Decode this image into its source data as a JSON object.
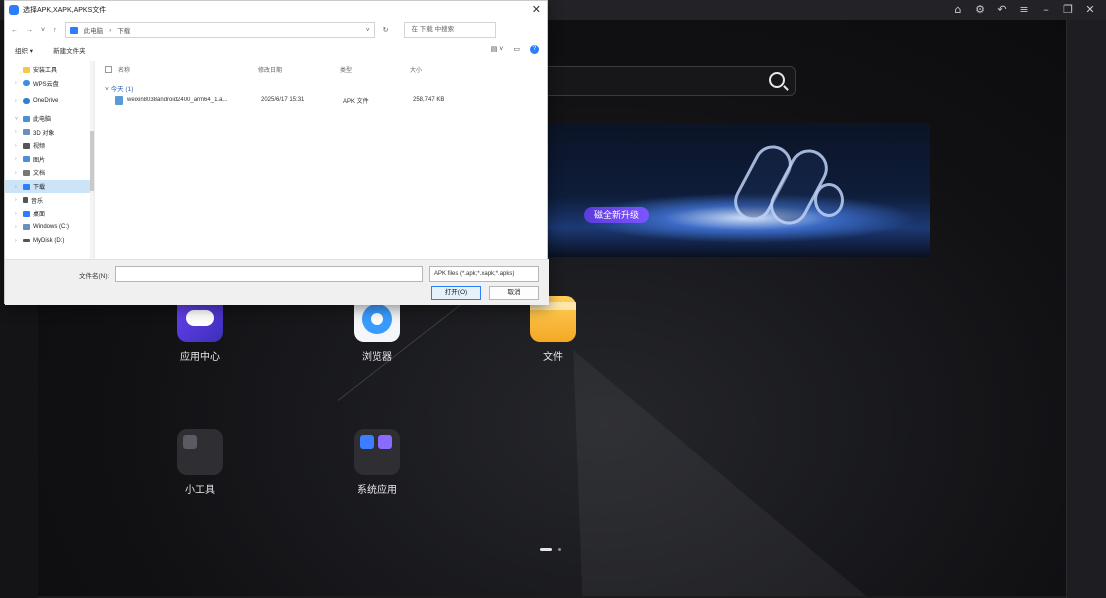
{
  "emulator": {
    "topbar_icons": [
      "home-icon",
      "settings-icon",
      "back-icon",
      "menu-icon",
      "minimize-icon",
      "restore-icon",
      "close-icon"
    ]
  },
  "home": {
    "banner_tag": "磁全新升级",
    "apps": [
      {
        "label": "应用中心",
        "icon": "game-center-icon"
      },
      {
        "label": "浏览器",
        "icon": "browser-icon"
      },
      {
        "label": "文件",
        "icon": "folder-icon"
      },
      {
        "label": "小工具",
        "icon": "tools-icon"
      },
      {
        "label": "系统应用",
        "icon": "system-apps-icon"
      }
    ]
  },
  "dialog": {
    "title": "选择APK,XAPK,APKS文件",
    "address": {
      "root": "此电脑",
      "current": "下载"
    },
    "search_placeholder": "在 下载 中搜索",
    "toolbar": {
      "organize": "组织 ▾",
      "new_folder": "新建文件夹"
    },
    "sidebar": [
      {
        "label": "安装工具",
        "color": "#f2c94c",
        "sub": true
      },
      {
        "label": "WPS云盘",
        "color": "#3a8ee6",
        "sub": false
      },
      {
        "label": "OneDrive",
        "color": "#2f7ed8",
        "sub": false
      },
      {
        "label": "此电脑",
        "color": "#4a90d9",
        "sub": false
      },
      {
        "label": "3D 对象",
        "color": "#6c8ebf",
        "sub": true
      },
      {
        "label": "视频",
        "color": "#555555",
        "sub": true
      },
      {
        "label": "图片",
        "color": "#4a90d9",
        "sub": true
      },
      {
        "label": "文档",
        "color": "#777777",
        "sub": true
      },
      {
        "label": "下载",
        "color": "#2d7dff",
        "sub": true,
        "selected": true
      },
      {
        "label": "音乐",
        "color": "#555555",
        "sub": true
      },
      {
        "label": "桌面",
        "color": "#2d7dff",
        "sub": true
      },
      {
        "label": "Windows (C:)",
        "color": "#6c8ebf",
        "sub": true
      },
      {
        "label": "MyDisk (D:)",
        "color": "#555555",
        "sub": true
      }
    ],
    "columns": [
      "名称",
      "修改日期",
      "类型",
      "大小"
    ],
    "group": "今天 (1)",
    "files": [
      {
        "name": "weixin8038android2400_arm64_1.a...",
        "date": "2025/6/17 15:31",
        "type": "APK 文件",
        "size": "258,747 KB"
      }
    ],
    "footer": {
      "filename_label": "文件名(N):",
      "filetype": "APK files (*.apk;*.xapk;*.apks)",
      "open": "打开(O)",
      "cancel": "取消"
    }
  }
}
